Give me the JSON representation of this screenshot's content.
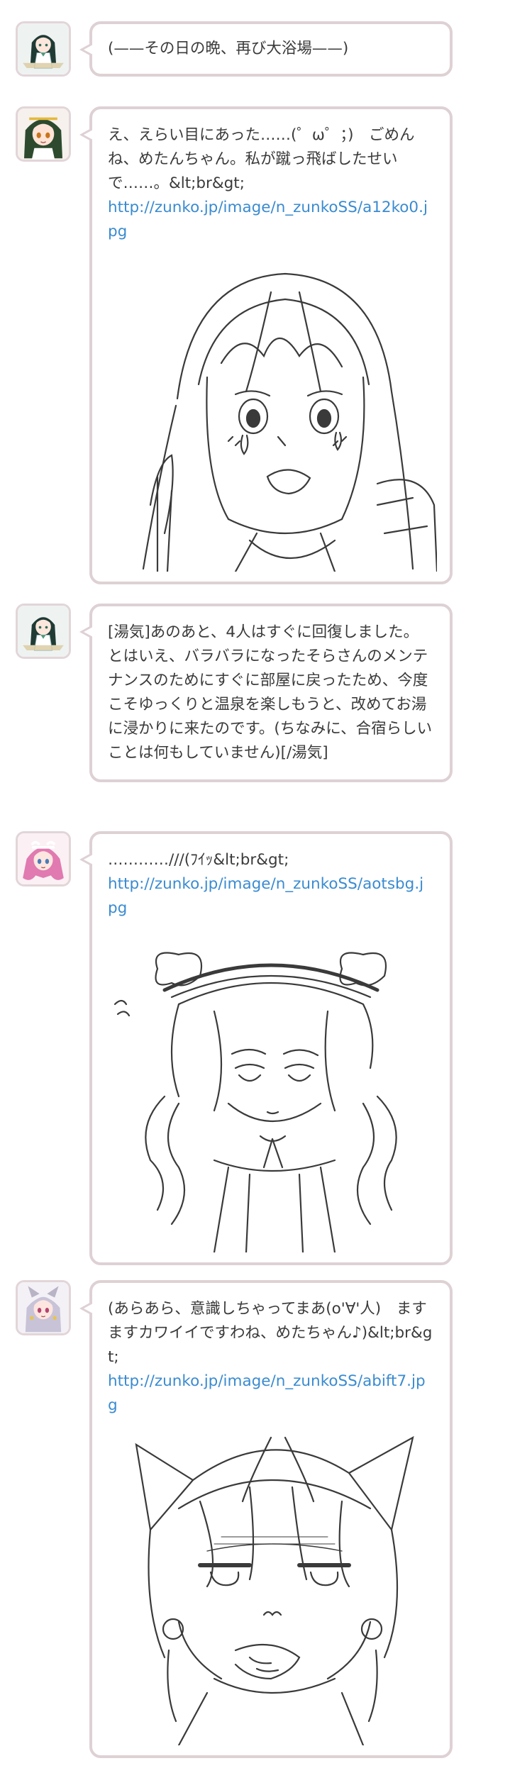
{
  "messages": [
    {
      "speaker_icon": "girl-dark-hair-avatar",
      "text": "(——その日の晩、再び大浴場——)"
    },
    {
      "speaker_icon": "girl-green-hair-avatar",
      "text": "え、えらい目にあった……(゜ω゜；)　ごめんね、めたんちゃん。私が蹴っ飛ばしたせいで……。&lt;br&gt;",
      "link": "http://zunko.jp/image/n_zunkoSS/a12ko0.jpg",
      "image_icon": "crying-girl-sketch"
    },
    {
      "speaker_icon": "girl-dark-hair-avatar",
      "text": "[湯気]あのあと、4人はすぐに回復しました。とはいえ、バラバラになったそらさんのメンテナンスのためにすぐに部屋に戻ったため、今度こそゆっくりと温泉を楽しもうと、改めてお湯に浸かりに来たのです。(ちなみに、合宿らしいことは何もしていません)[/湯気]"
    },
    {
      "speaker_icon": "girl-pink-hair-avatar",
      "text": "…………///(ﾌｲｯ&lt;br&gt;",
      "link": "http://zunko.jp/image/n_zunkoSS/aotsbg.jpg",
      "image_icon": "twin-drill-girl-sketch"
    },
    {
      "speaker_icon": "girl-silver-hair-avatar",
      "text": "(あらあら、意識しちゃってまあ(o'∀'人)　ますますカワイイですわね、めたちゃん♪)&lt;br&gt;",
      "link": "http://zunko.jp/image/n_zunkoSS/abift7.jpg",
      "image_icon": "fox-ear-girl-sketch"
    }
  ],
  "colors": {
    "bubble_border": "#ded1d4",
    "avatar_border": "#e2d5d8",
    "link": "#3a8bd0",
    "text": "#3a3a3a"
  }
}
